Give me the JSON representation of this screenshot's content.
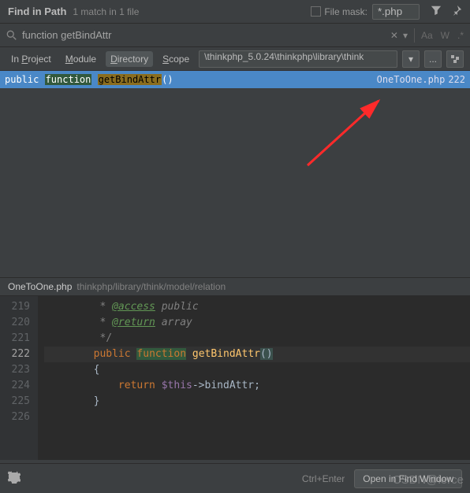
{
  "header": {
    "title": "Find in Path",
    "subtitle": "1 match in 1 file",
    "file_mask_label": "File mask:",
    "file_mask_value": "*.php"
  },
  "search": {
    "value": "function getBindAttr",
    "case_icon": "Aa",
    "word_icon": "W",
    "regex_icon": ".*"
  },
  "scope": {
    "tabs": [
      "In Project",
      "Module",
      "Directory",
      "Scope"
    ],
    "selected": 2,
    "path": "\\thinkphp_5.0.24\\thinkphp\\library\\think"
  },
  "result": {
    "prefix": "public ",
    "hl1": "function",
    "hl2": "getBindAttr",
    "suffix": "()",
    "file": "OneToOne.php",
    "line": "222"
  },
  "preview": {
    "file": "OneToOne.php",
    "path": "thinkphp/library/think/model/relation"
  },
  "code": {
    "lines": [
      {
        "n": "219",
        "text": "         * @access public",
        "cls": "doc"
      },
      {
        "n": "220",
        "text": "         * @return array",
        "cls": "doc2"
      },
      {
        "n": "221",
        "text": "         */",
        "cls": "docend"
      },
      {
        "n": "222",
        "text": "        public function getBindAttr()",
        "cls": "cur"
      },
      {
        "n": "223",
        "text": "        {",
        "cls": ""
      },
      {
        "n": "224",
        "text": "            return $this->bindAttr;",
        "cls": ""
      },
      {
        "n": "225",
        "text": "        }",
        "cls": ""
      },
      {
        "n": "226",
        "text": "",
        "cls": ""
      }
    ]
  },
  "footer": {
    "hint": "Ctrl+Enter",
    "open": "Open in Find Window"
  },
  "watermark": "CSDN@ierce"
}
